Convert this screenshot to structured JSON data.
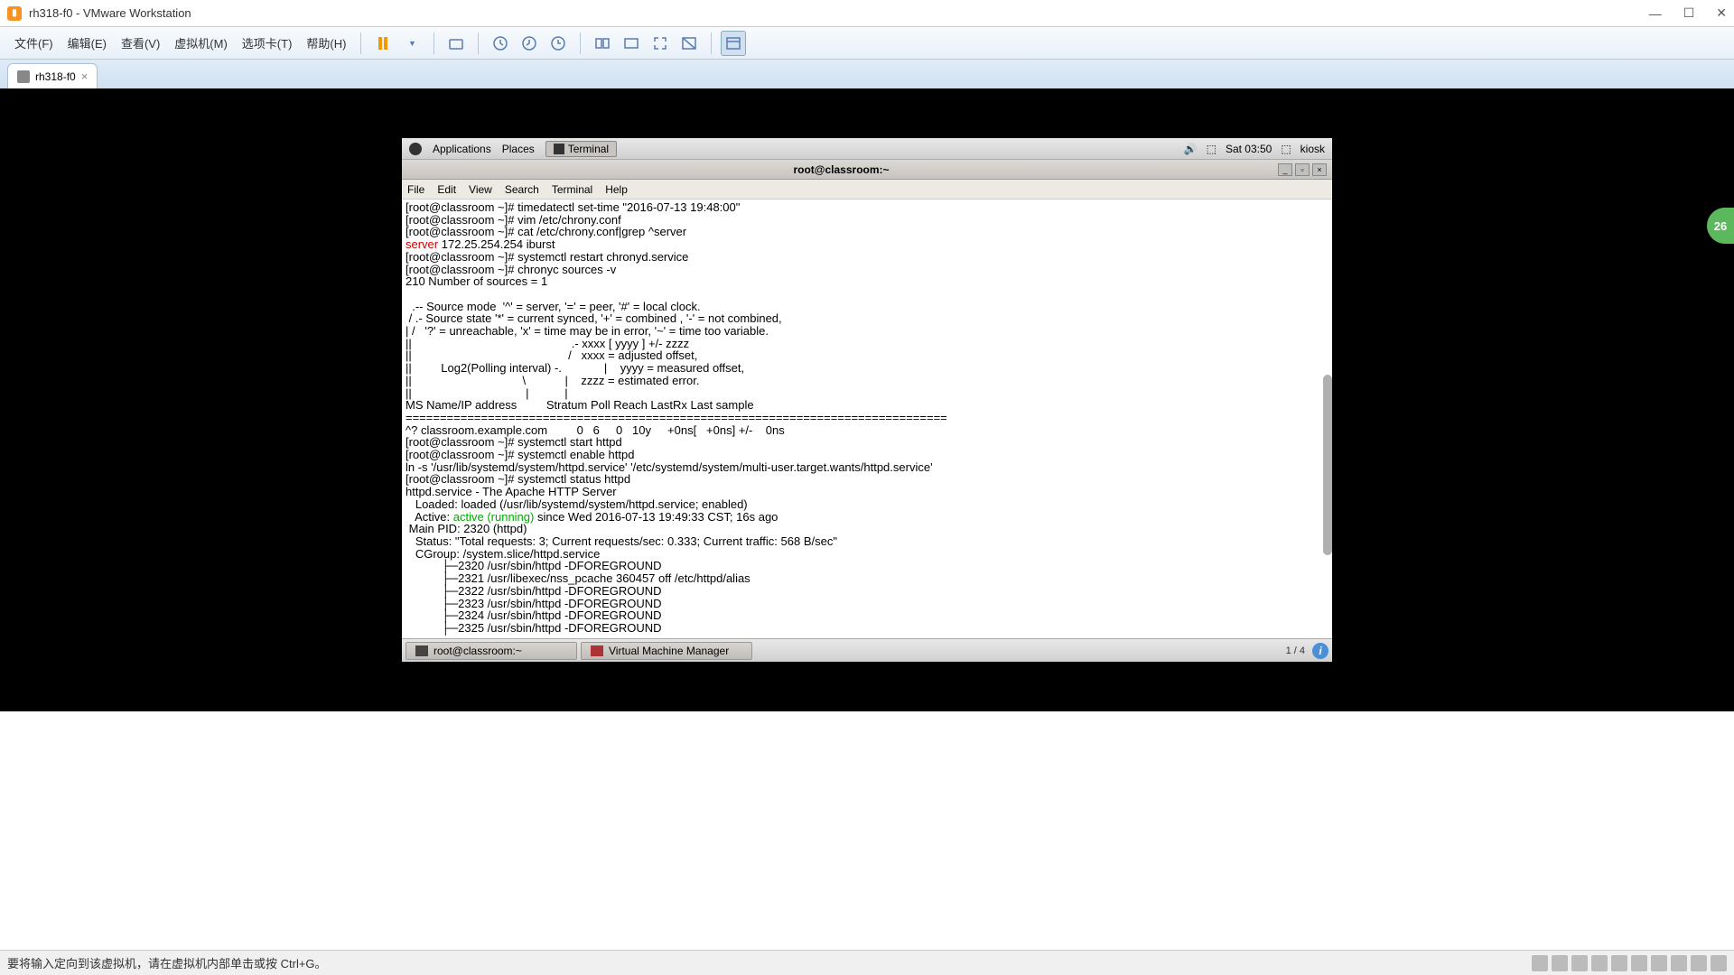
{
  "window": {
    "title": "rh318-f0 - VMware Workstation"
  },
  "menu": {
    "file": "文件(F)",
    "edit": "编辑(E)",
    "view": "查看(V)",
    "vm": "虚拟机(M)",
    "tabs": "选项卡(T)",
    "help": "帮助(H)"
  },
  "tab": {
    "name": "rh318-f0"
  },
  "gnome_top": {
    "apps": "Applications",
    "places": "Places",
    "terminal": "Terminal",
    "time": "Sat 03:50",
    "user": "kiosk"
  },
  "term": {
    "title": "root@classroom:~",
    "menu": {
      "file": "File",
      "edit": "Edit",
      "view": "View",
      "search": "Search",
      "terminal": "Terminal",
      "help": "Help"
    },
    "lines": [
      {
        "t": "[root@classroom ~]# timedatectl set-time \"2016-07-13 19:48:00\""
      },
      {
        "t": "[root@classroom ~]# vim /etc/chrony.conf"
      },
      {
        "t": "[root@classroom ~]# cat /etc/chrony.conf|grep ^server"
      },
      {
        "pre": "server",
        "cls": "red",
        "post": " 172.25.254.254 iburst"
      },
      {
        "t": "[root@classroom ~]# systemctl restart chronyd.service"
      },
      {
        "t": "[root@classroom ~]# chronyc sources -v"
      },
      {
        "t": "210 Number of sources = 1"
      },
      {
        "t": ""
      },
      {
        "t": "  .-- Source mode  '^' = server, '=' = peer, '#' = local clock."
      },
      {
        "t": " / .- Source state '*' = current synced, '+' = combined , '-' = not combined,"
      },
      {
        "t": "| /   '?' = unreachable, 'x' = time may be in error, '~' = time too variable."
      },
      {
        "t": "||                                                 .- xxxx [ yyyy ] +/- zzzz"
      },
      {
        "t": "||                                                /   xxxx = adjusted offset,"
      },
      {
        "t": "||         Log2(Polling interval) -.             |    yyyy = measured offset,"
      },
      {
        "t": "||                                  \\            |    zzzz = estimated error."
      },
      {
        "t": "||                                   |           |"
      },
      {
        "t": "MS Name/IP address         Stratum Poll Reach LastRx Last sample"
      },
      {
        "t": "==============================================================================="
      },
      {
        "t": "^? classroom.example.com         0   6     0   10y     +0ns[   +0ns] +/-    0ns"
      },
      {
        "t": "[root@classroom ~]# systemctl start httpd"
      },
      {
        "t": "[root@classroom ~]# systemctl enable httpd"
      },
      {
        "t": "ln -s '/usr/lib/systemd/system/httpd.service' '/etc/systemd/system/multi-user.target.wants/httpd.service'"
      },
      {
        "t": "[root@classroom ~]# systemctl status httpd"
      },
      {
        "t": "httpd.service - The Apache HTTP Server"
      },
      {
        "t": "   Loaded: loaded (/usr/lib/systemd/system/httpd.service; enabled)"
      },
      {
        "pre": "   Active: ",
        "mid": "active (running)",
        "cls": "green",
        "post": " since Wed 2016-07-13 19:49:33 CST; 16s ago"
      },
      {
        "t": " Main PID: 2320 (httpd)"
      },
      {
        "t": "   Status: \"Total requests: 3; Current requests/sec: 0.333; Current traffic: 568 B/sec\""
      },
      {
        "t": "   CGroup: /system.slice/httpd.service"
      },
      {
        "t": "           ├─2320 /usr/sbin/httpd -DFOREGROUND"
      },
      {
        "t": "           ├─2321 /usr/libexec/nss_pcache 360457 off /etc/httpd/alias"
      },
      {
        "t": "           ├─2322 /usr/sbin/httpd -DFOREGROUND"
      },
      {
        "t": "           ├─2323 /usr/sbin/httpd -DFOREGROUND"
      },
      {
        "t": "           ├─2324 /usr/sbin/httpd -DFOREGROUND"
      },
      {
        "t": "           ├─2325 /usr/sbin/httpd -DFOREGROUND"
      }
    ]
  },
  "taskbar": {
    "t1": "root@classroom:~",
    "t2": "Virtual Machine Manager",
    "ws": "1 / 4"
  },
  "status": {
    "msg": "要将输入定向到该虚拟机，请在虚拟机内部单击或按 Ctrl+G。"
  },
  "badge": "26"
}
